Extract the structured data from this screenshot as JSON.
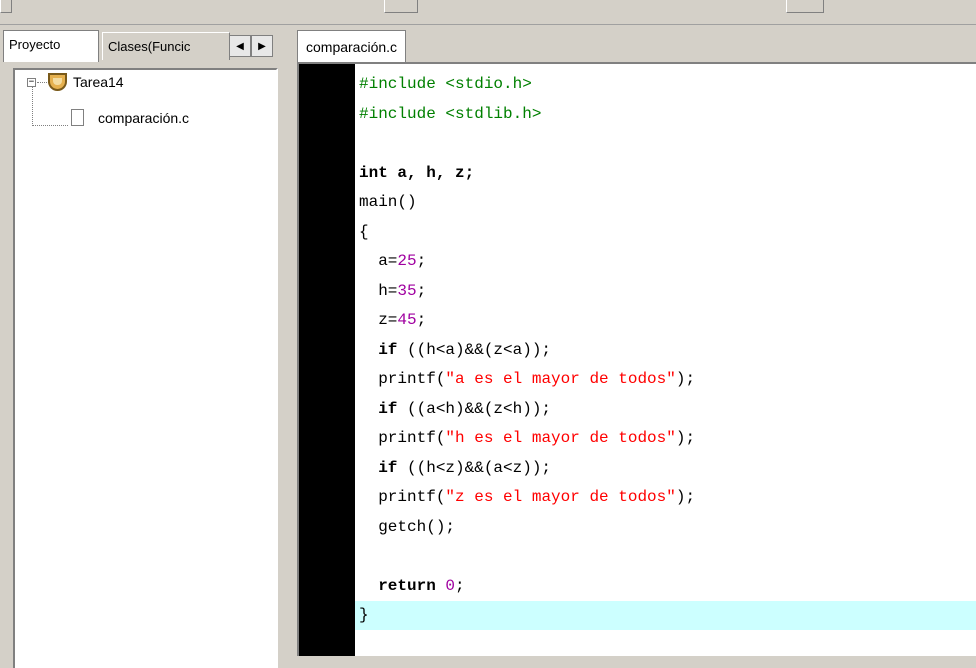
{
  "left_panel": {
    "tabs": [
      {
        "label": "Proyecto"
      },
      {
        "label": "Clases(Funcic"
      }
    ],
    "arrows": {
      "left": "◀",
      "right": "▶"
    },
    "tree": {
      "project": {
        "label": "Tarea14",
        "expander": "−"
      },
      "file": {
        "label": "comparación.c"
      }
    }
  },
  "editor": {
    "tab_label": "comparación.c",
    "lines": [
      [
        {
          "t": "#include <stdio.h>",
          "c": "pp"
        }
      ],
      [
        {
          "t": "#include <stdlib.h>",
          "c": "pp"
        }
      ],
      [
        {
          "t": ""
        }
      ],
      [
        {
          "t": "int a, h, z;",
          "c": "kw"
        }
      ],
      [
        {
          "t": "main()"
        }
      ],
      [
        {
          "t": "{"
        }
      ],
      [
        {
          "t": "  a="
        },
        {
          "t": "25",
          "c": "num"
        },
        {
          "t": ";"
        }
      ],
      [
        {
          "t": "  h="
        },
        {
          "t": "35",
          "c": "num"
        },
        {
          "t": ";"
        }
      ],
      [
        {
          "t": "  z="
        },
        {
          "t": "45",
          "c": "num"
        },
        {
          "t": ";"
        }
      ],
      [
        {
          "t": "  "
        },
        {
          "t": "if",
          "c": "kw"
        },
        {
          "t": " ((h<a)&&(z<a));"
        }
      ],
      [
        {
          "t": "  printf("
        },
        {
          "t": "\"a es el mayor de todos\"",
          "c": "str"
        },
        {
          "t": ");"
        }
      ],
      [
        {
          "t": "  "
        },
        {
          "t": "if",
          "c": "kw"
        },
        {
          "t": " ((a<h)&&(z<h));"
        }
      ],
      [
        {
          "t": "  printf("
        },
        {
          "t": "\"h es el mayor de todos\"",
          "c": "str"
        },
        {
          "t": ");"
        }
      ],
      [
        {
          "t": "  "
        },
        {
          "t": "if",
          "c": "kw"
        },
        {
          "t": " ((h<z)&&(a<z));"
        }
      ],
      [
        {
          "t": "  printf("
        },
        {
          "t": "\"z es el mayor de todos\"",
          "c": "str"
        },
        {
          "t": ");"
        }
      ],
      [
        {
          "t": "  getch();"
        }
      ],
      [
        {
          "t": ""
        }
      ],
      [
        {
          "t": "  "
        },
        {
          "t": "return",
          "c": "kw"
        },
        {
          "t": " "
        },
        {
          "t": "0",
          "c": "num"
        },
        {
          "t": ";"
        }
      ],
      [
        {
          "t": "}"
        }
      ]
    ],
    "current_line": 19
  },
  "colors": {
    "preprocessor": "#008000",
    "number": "#a000a0",
    "string": "#ff0000",
    "current_line_bg": "#ccffff",
    "gutter": "#000000"
  }
}
